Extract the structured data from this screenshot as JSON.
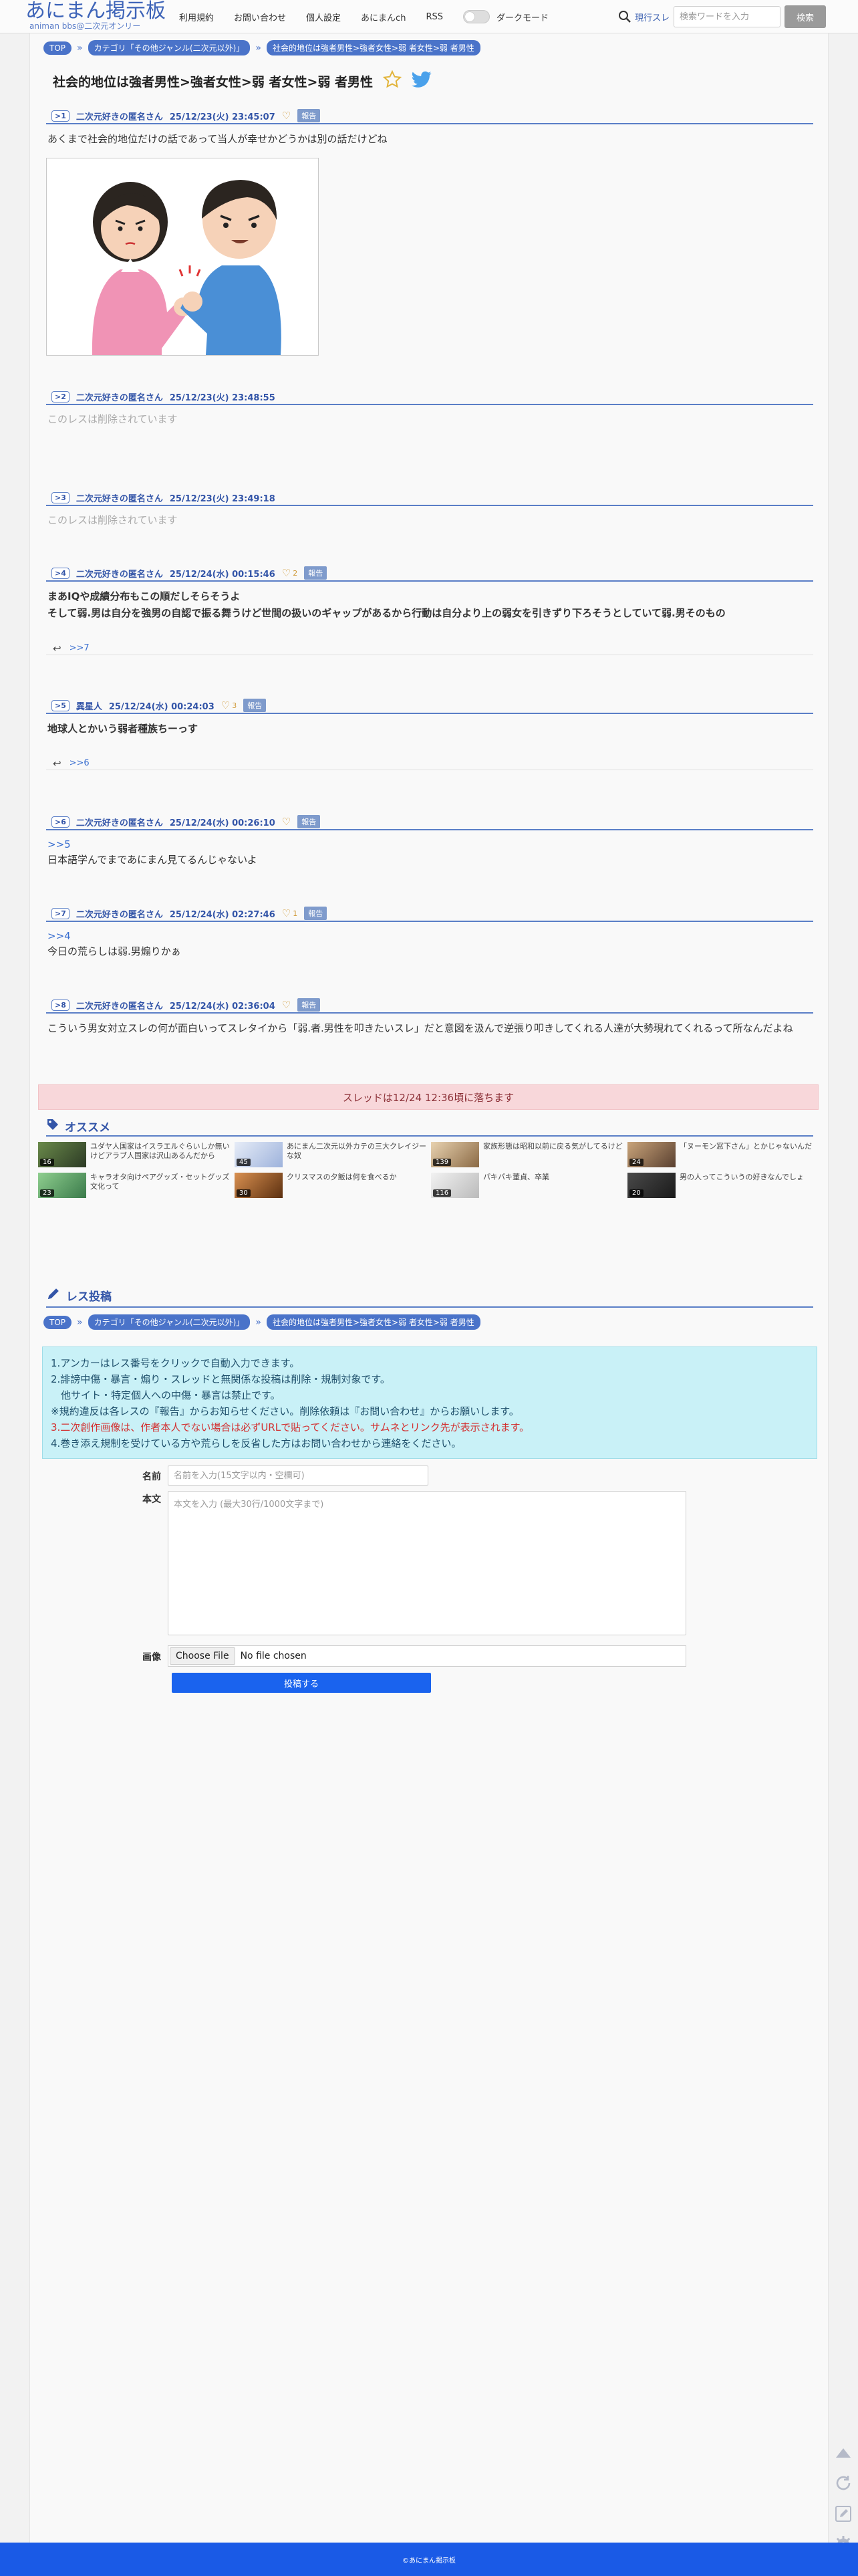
{
  "header": {
    "logo_main": "あにまん掲示板",
    "logo_sub": "animan bbs@二次元オンリー",
    "nav": [
      "利用規約",
      "お問い合わせ",
      "個人設定",
      "あにまんch",
      "RSS"
    ],
    "dark_mode_label": "ダークモード",
    "search_select": "現行スレ",
    "search_placeholder": "検索ワードを入力",
    "search_button": "検索"
  },
  "breadcrumb": [
    "TOP",
    "カテゴリ「その他ジャンル(二次元以外)」",
    "社会的地位は強者男性>強者女性>弱 者女性>弱 者男性"
  ],
  "thread": {
    "title": "社会的地位は強者男性>強者女性>弱 者女性>弱 者男性"
  },
  "posts": [
    {
      "num": "1",
      "name": "二次元好きの匿名さん",
      "date": "25/12/23(火) 23:45:07",
      "likes": "",
      "report": "報告",
      "body": "あくまで社会的地位だけの話であって当人が幸せかどうかは別の話だけどね"
    },
    {
      "num": "2",
      "name": "二次元好きの匿名さん",
      "date": "25/12/23(火) 23:48:55",
      "body": "このレスは削除されています"
    },
    {
      "num": "3",
      "name": "二次元好きの匿名さん",
      "date": "25/12/23(火) 23:49:18",
      "body": "このレスは削除されています"
    },
    {
      "num": "4",
      "name": "二次元好きの匿名さん",
      "date": "25/12/24(水) 00:15:46",
      "likes": "2",
      "report": "報告",
      "body_1": "まあIQや成績分布もこの順だしそらそうよ",
      "body_2": "そして弱.男は自分を強男の自認で振る舞うけど世間の扱いのギャップがあるから行動は自分より上の弱女を引きずり下ろそうとしていて弱.男そのもの",
      "reply": ">>7"
    },
    {
      "num": "5",
      "name": "異星人",
      "date": "25/12/24(水) 00:24:03",
      "likes": "3",
      "report": "報告",
      "body": "地球人とかいう弱者種族ちーっす",
      "reply": ">>6"
    },
    {
      "num": "6",
      "name": "二次元好きの匿名さん",
      "date": "25/12/24(水) 00:26:10",
      "likes": "",
      "report": "報告",
      "anchor": ">>5",
      "body": "日本語学んでまであにまん見てるんじゃないよ"
    },
    {
      "num": "7",
      "name": "二次元好きの匿名さん",
      "date": "25/12/24(水) 02:27:46",
      "likes": "1",
      "report": "報告",
      "anchor": ">>4",
      "body": "今日の荒らしは弱.男煽りかぁ"
    },
    {
      "num": "8",
      "name": "二次元好きの匿名さん",
      "date": "25/12/24(水) 02:36:04",
      "likes": "",
      "report": "報告",
      "body": "こういう男女対立スレの何が面白いってスレタイから「弱.者.男性を叩きたいスレ」だと意図を汲んで逆張り叩きしてくれる人達が大勢現れてくれるって所なんだよね"
    }
  ],
  "expire_banner": "スレッドは12/24 12:36頃に落ちます",
  "recommend": {
    "title": "オススメ",
    "items": [
      {
        "count": "16",
        "text": "ユダヤ人国家はイスラエルぐらいしか無いけどアラブ人国家は沢山あるんだから"
      },
      {
        "count": "45",
        "text": "あにまん二次元以外カテの三大クレイジーな奴"
      },
      {
        "count": "139",
        "text": "家族形態は昭和以前に戻る気がしてるけど"
      },
      {
        "count": "24",
        "text": "「ヌーモン窓下さん」とかじゃないんだ"
      },
      {
        "count": "23",
        "text": "キャラオタ向けペアグッズ・セットグッズ文化って"
      },
      {
        "count": "30",
        "text": "クリスマスの夕飯は何を食べるか"
      },
      {
        "count": "116",
        "text": "パキパキ董貞、卒業"
      },
      {
        "count": "20",
        "text": "男の人ってこういうの好きなんでしょ"
      }
    ]
  },
  "post_form": {
    "title": "レス投稿",
    "guide": [
      "1.アンカーはレス番号をクリックで自動入力できます。",
      "2.誹謗中傷・暴言・煽り・スレッドと無関係な投稿は削除・規制対象です。",
      "　他サイト・特定個人への中傷・暴言は禁止です。",
      "※規約違反は各レスの『報告』からお知らせください。削除依頼は『お問い合わせ』からお願いします。",
      "3.二次創作画像は、作者本人でない場合は必ずURLで貼ってください。サムネとリンク先が表示されます。",
      "4.巻き添え規制を受けている方や荒らしを反省した方はお問い合わせから連絡をください。"
    ],
    "name_label": "名前",
    "name_placeholder": "名前を入力(15文字以内・空欄可)",
    "body_label": "本文",
    "body_placeholder": "本文を入力 (最大30行/1000文字まで)",
    "image_label": "画像",
    "file_button": "Choose File",
    "file_status": "No file chosen",
    "submit": "投稿する"
  },
  "footer": "©あにまん掲示板",
  "colors": {
    "accent": "#3355a8",
    "footer": "#1a5ae6",
    "banner": "#f8d7da",
    "guide": "#c9f1f7"
  }
}
